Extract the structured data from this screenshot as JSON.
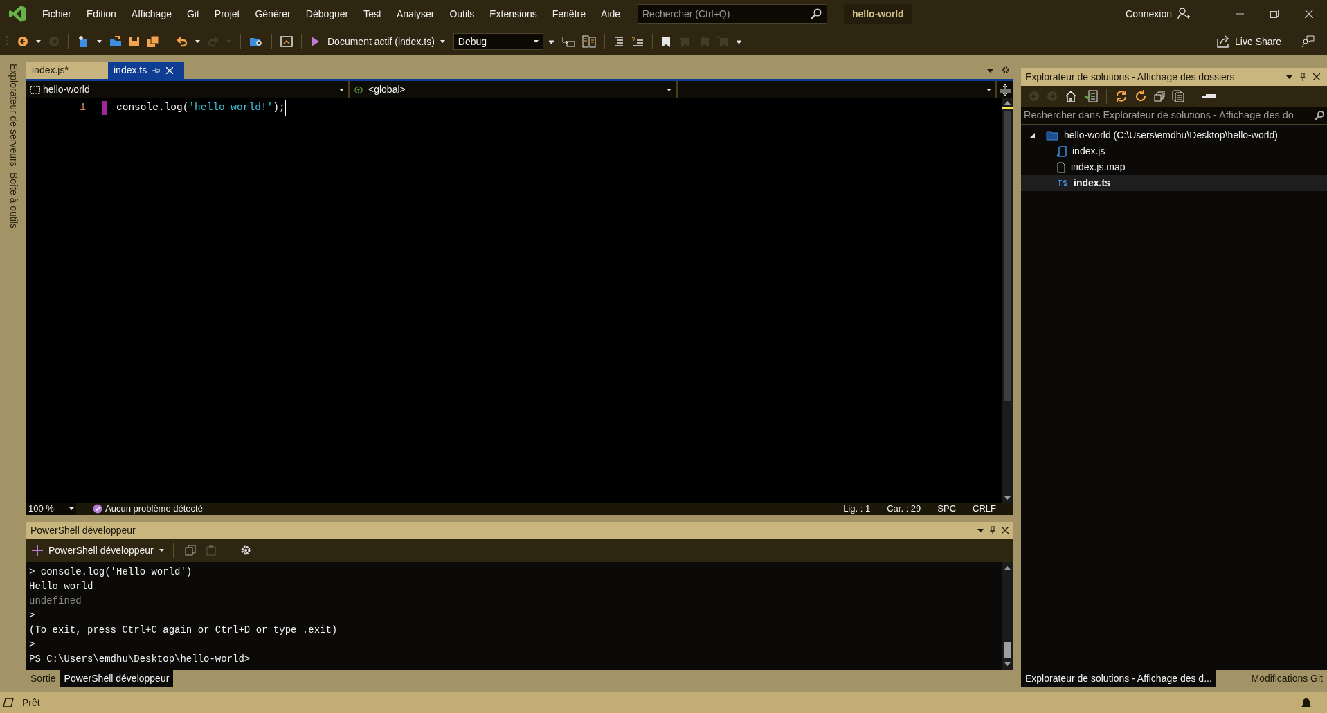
{
  "menu_bar": {
    "items": [
      {
        "label": "Fichier"
      },
      {
        "label": "Edition"
      },
      {
        "label": "Affichage"
      },
      {
        "label": "Git"
      },
      {
        "label": "Projet"
      },
      {
        "label": "Générer"
      },
      {
        "label": "Déboguer"
      },
      {
        "label": "Test"
      },
      {
        "label": "Analyser"
      },
      {
        "label": "Outils"
      },
      {
        "label": "Extensions"
      },
      {
        "label": "Fenêtre"
      },
      {
        "label": "Aide"
      }
    ],
    "search": {
      "placeholder": "Rechercher (Ctrl+Q)"
    },
    "solution_name": "hello-world",
    "account": "Connexion"
  },
  "toolbar": {
    "left_buttons": [
      {
        "kind": "back",
        "disabled": false
      },
      {
        "kind": "caret",
        "disabled": false
      },
      {
        "kind": "forward",
        "disabled": true
      },
      {
        "kind": "separator"
      },
      {
        "kind": "new",
        "disabled": false
      },
      {
        "kind": "caret",
        "disabled": false
      },
      {
        "kind": "open",
        "disabled": false
      },
      {
        "kind": "save",
        "disabled": false
      },
      {
        "kind": "save-all",
        "disabled": false
      },
      {
        "kind": "separator"
      },
      {
        "kind": "undo",
        "disabled": false
      },
      {
        "kind": "caret",
        "disabled": false
      },
      {
        "kind": "redo",
        "disabled": true
      },
      {
        "kind": "caret",
        "disabled": true
      },
      {
        "kind": "separator"
      },
      {
        "kind": "find",
        "disabled": false
      },
      {
        "kind": "separator"
      },
      {
        "kind": "browser",
        "disabled": false
      },
      {
        "kind": "separator"
      },
      {
        "kind": "play",
        "disabled": false
      }
    ],
    "run_label": "Document actif (index.ts)",
    "config": "Debug",
    "right_buttons": [
      {
        "kind": "overflow",
        "disabled": false
      },
      {
        "kind": "step",
        "disabled": false
      },
      {
        "kind": "columns",
        "disabled": false
      },
      {
        "kind": "separator"
      },
      {
        "kind": "lines",
        "disabled": false
      },
      {
        "kind": "lines-q",
        "disabled": false
      },
      {
        "kind": "separator"
      },
      {
        "kind": "bookmark",
        "disabled": false
      },
      {
        "kind": "bookmark-prev",
        "disabled": true
      },
      {
        "kind": "bookmark-next",
        "disabled": true
      },
      {
        "kind": "bookmark-clear",
        "disabled": true
      },
      {
        "kind": "overflow",
        "disabled": false
      }
    ],
    "live_share": "Live Share"
  },
  "side_strip": [
    {
      "label": "Explorateur de serveurs"
    },
    {
      "label": "Boîte à outils"
    }
  ],
  "editor": {
    "tabs": [
      {
        "label": "index.js*",
        "selected": false
      },
      {
        "label": "index.ts",
        "selected": true
      }
    ],
    "project_combo": "hello-world",
    "scope_combo": "<global>",
    "lines": [
      {
        "number": "1",
        "parts": [
          {
            "text": "console.log(",
            "kind": "plain"
          },
          {
            "text": "'hello world!'",
            "kind": "string"
          },
          {
            "text": ");",
            "kind": "plain"
          }
        ]
      }
    ],
    "status": {
      "zoom": "100 %",
      "issues": "Aucun problème détecté",
      "line": "Lig. : 1",
      "column": "Car. : 29",
      "spaces": "SPC",
      "line_end": "CRLF"
    }
  },
  "terminal_panel": {
    "title": "PowerShell développeur",
    "new_button": "PowerShell développeur",
    "lines": [
      {
        "text": "> console.log('Hello world')",
        "kind": "normal"
      },
      {
        "text": "Hello world",
        "kind": "normal"
      },
      {
        "text": "undefined",
        "kind": "dim"
      },
      {
        "text": ">",
        "kind": "normal"
      },
      {
        "text": "(To exit, press Ctrl+C again or Ctrl+D or type .exit)",
        "kind": "normal"
      },
      {
        "text": ">",
        "kind": "normal"
      },
      {
        "text": "PS C:\\Users\\emdhu\\Desktop\\hello-world>",
        "kind": "normal"
      }
    ],
    "tabs": [
      {
        "label": "Sortie",
        "selected": false
      },
      {
        "label": "PowerShell développeur",
        "selected": true
      }
    ]
  },
  "solution_explorer": {
    "title": "Explorateur de solutions - Affichage des dossiers",
    "buttons": [
      {
        "kind": "back",
        "disabled": true
      },
      {
        "kind": "forward",
        "disabled": true
      },
      {
        "kind": "home",
        "disabled": false
      },
      {
        "kind": "vs-file",
        "disabled": false
      },
      {
        "kind": "separator"
      },
      {
        "kind": "sync",
        "disabled": false
      },
      {
        "kind": "refresh",
        "disabled": false
      },
      {
        "kind": "collapse",
        "disabled": false
      },
      {
        "kind": "copy",
        "disabled": false
      },
      {
        "kind": "separator"
      },
      {
        "kind": "minus",
        "disabled": false
      }
    ],
    "search_placeholder": "Rechercher dans Explorateur de solutions - Affichage des do",
    "tree": [
      {
        "label": "hello-world (C:\\Users\\emdhu\\Desktop\\hello-world)",
        "kind": "folder",
        "expanded": true,
        "selected": false,
        "children": [
          {
            "label": "index.js",
            "kind": "js",
            "selected": false
          },
          {
            "label": "index.js.map",
            "kind": "file",
            "selected": false
          },
          {
            "label": "index.ts",
            "kind": "ts",
            "selected": true
          }
        ]
      }
    ],
    "tabs": [
      {
        "label": "Explorateur de solutions - Affichage des d...",
        "selected": true
      },
      {
        "label": "Modifications Git",
        "selected": false
      }
    ]
  },
  "status_bar": {
    "text": "Prêt"
  }
}
